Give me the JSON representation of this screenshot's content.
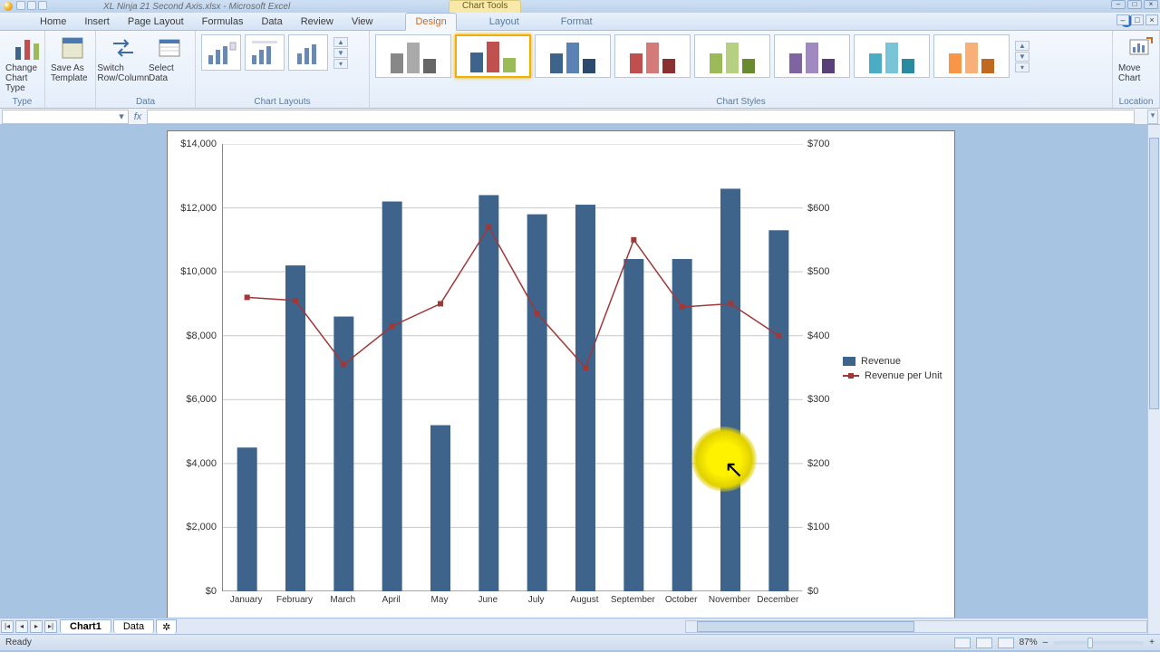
{
  "app": {
    "doc_title": "XL Ninja 21 Second Axis.xlsx - Microsoft Excel",
    "chart_tools": "Chart Tools"
  },
  "tabs": {
    "home": "Home",
    "insert": "Insert",
    "page_layout": "Page Layout",
    "formulas": "Formulas",
    "data": "Data",
    "review": "Review",
    "view": "View",
    "design": "Design",
    "layout": "Layout",
    "format": "Format"
  },
  "ribbon": {
    "change_chart_type": "Change Chart Type",
    "save_as_template": "Save As Template",
    "switch_row_column": "Switch Row/Column",
    "select_data": "Select Data",
    "move_chart": "Move Chart",
    "group_type": "Type",
    "group_data": "Data",
    "group_layouts": "Chart Layouts",
    "group_styles": "Chart Styles",
    "group_location": "Location"
  },
  "formula_bar": {
    "fx": "fx"
  },
  "legend": {
    "s1": "Revenue",
    "s2": "Revenue per Unit"
  },
  "sheets": {
    "chart1": "Chart1",
    "data": "Data"
  },
  "status": {
    "ready": "Ready",
    "zoom": "87%"
  },
  "chart_data": {
    "type": "bar",
    "categories": [
      "January",
      "February",
      "March",
      "April",
      "May",
      "June",
      "July",
      "August",
      "September",
      "October",
      "November",
      "December"
    ],
    "series": [
      {
        "name": "Revenue",
        "type": "bar",
        "axis": "primary",
        "values": [
          4500,
          10200,
          8600,
          12200,
          5200,
          12400,
          11800,
          12100,
          10400,
          10400,
          12600,
          11300
        ]
      },
      {
        "name": "Revenue per Unit",
        "type": "line",
        "axis": "secondary",
        "values": [
          460,
          455,
          355,
          415,
          450,
          570,
          435,
          350,
          550,
          445,
          450,
          400
        ]
      }
    ],
    "ylabel": "",
    "xlabel": "",
    "ylim": [
      0,
      14000
    ],
    "y_ticks": [
      "$0",
      "$2,000",
      "$4,000",
      "$6,000",
      "$8,000",
      "$10,000",
      "$12,000",
      "$14,000"
    ],
    "y2lim": [
      0,
      700
    ],
    "y2_ticks": [
      "$0",
      "$100",
      "$200",
      "$300",
      "$400",
      "$500",
      "$600",
      "$700"
    ]
  }
}
